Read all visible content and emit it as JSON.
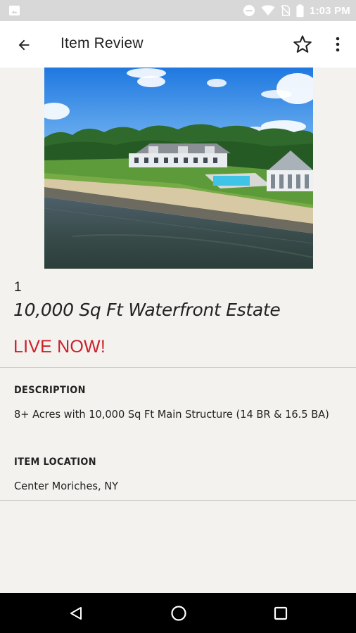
{
  "status_bar": {
    "time": "1:03 PM",
    "icons": [
      "image-icon",
      "minus-circle-icon",
      "wifi-icon",
      "no-sim-icon",
      "battery-icon"
    ]
  },
  "app_bar": {
    "title": "Item Review",
    "back_icon": "arrow-back-icon",
    "favorite_icon": "star-outline-icon",
    "more_icon": "more-vert-icon"
  },
  "item": {
    "photo_alt": "Waterfront estate aerial photo",
    "lot_number": "1",
    "title": "10,000 Sq Ft Waterfront Estate",
    "status": "LIVE NOW!",
    "status_color": "#cc1f2b"
  },
  "sections": {
    "description": {
      "label": "DESCRIPTION",
      "value": "8+ Acres with 10,000 Sq Ft Main Structure (14 BR & 16.5 BA)"
    },
    "location": {
      "label": "ITEM LOCATION",
      "value": "Center Moriches, NY"
    }
  },
  "nav_bar": {
    "icons": [
      "back-triangle-icon",
      "home-circle-icon",
      "recents-square-icon"
    ]
  }
}
